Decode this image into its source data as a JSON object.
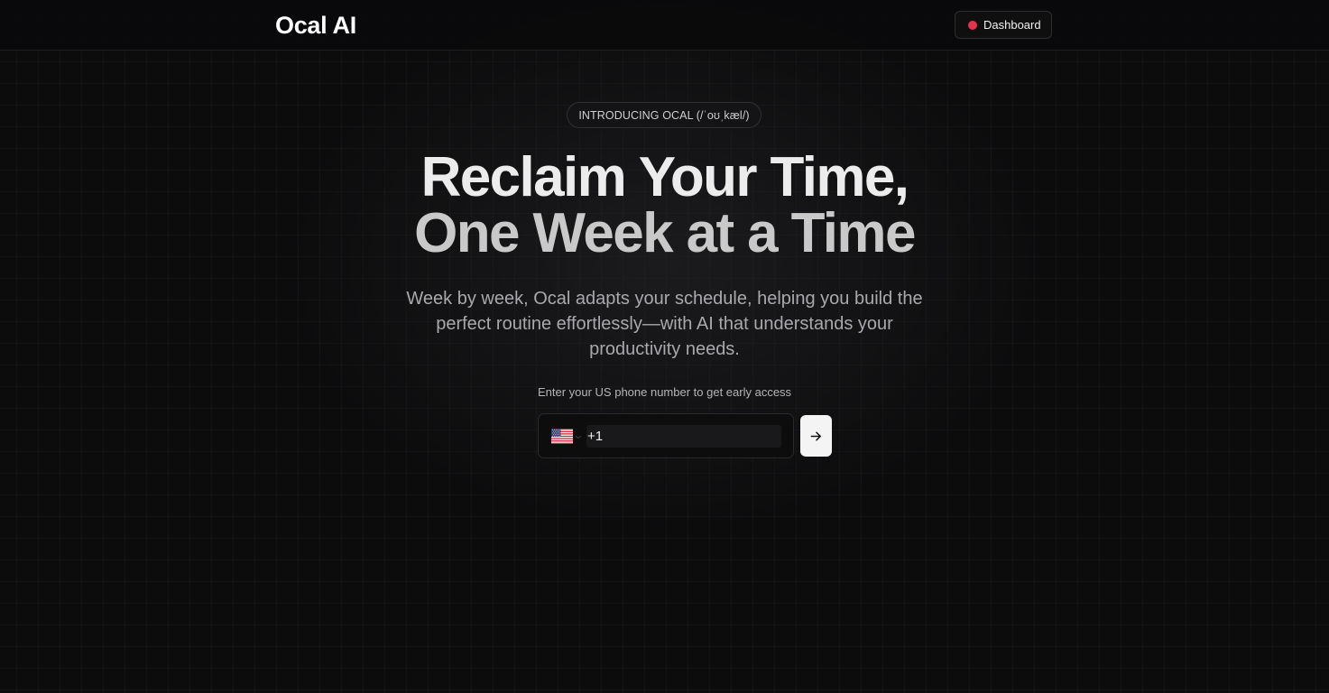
{
  "header": {
    "logo": "Ocal AI",
    "dashboard_label": "Dashboard",
    "status_color": "#e5334b"
  },
  "hero": {
    "pill": "INTRODUCING OCAL (/ˈoʊˌkæl/)",
    "headline_line1": "Reclaim Your Time,",
    "headline_line2": "One Week at a Time",
    "sub_line1": "Week by week, Ocal adapts your schedule, helping you build the",
    "sub_line2": "perfect routine effortlessly—with AI that understands your",
    "sub_line3": "productivity needs."
  },
  "signup": {
    "label": "Enter your US phone number to get early access",
    "country_flag": "us-flag-icon",
    "phone_value": "+1",
    "submit_icon": "arrow-right-icon"
  }
}
